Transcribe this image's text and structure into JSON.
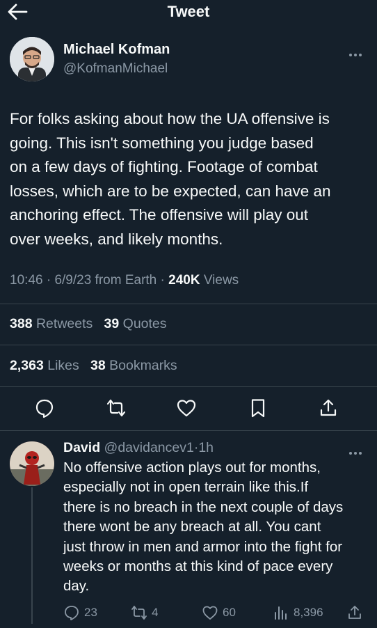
{
  "header": {
    "title": "Tweet",
    "back_icon": "arrow-left-icon"
  },
  "tweet": {
    "author_name": "Michael Kofman",
    "author_handle": "@KofmanMichael",
    "text_lines": [
      "For folks asking about how the UA offensive is",
      "going. This isn't something you judge based",
      "on a few days of fighting. Footage of combat",
      "losses, which are to be expected, can have an",
      "anchoring effect. The offensive will play out",
      "over weeks, and likely months."
    ],
    "time": "10:46",
    "date": "6/9/23",
    "source": "from Earth",
    "separator": "·",
    "views_count": "240K",
    "views_label": "Views",
    "retweets_count": "388",
    "retweets_label": "Retweets",
    "quotes_count": "39",
    "quotes_label": "Quotes",
    "likes_count": "2,363",
    "likes_label": "Likes",
    "bookmarks_count": "38",
    "bookmarks_label": "Bookmarks"
  },
  "reply": {
    "author_name": "David",
    "author_handle": "@davidancev1",
    "separator": "·",
    "age": "1h",
    "text_lines": [
      "No offensive action plays out for months,",
      "especially not in open terrain like this.If",
      "there is no breach in the next couple of days",
      "there wont be any breach at all. You cant",
      "just throw in men and armor into the fight for",
      "weeks or months at this kind of pace every",
      "day."
    ],
    "replies": "23",
    "retweets": "4",
    "likes": "60",
    "views": "8,396"
  },
  "colors": {
    "background": "#15202b",
    "text": "#f7f9f9",
    "secondary": "#8b98a5",
    "divider": "#38444d"
  }
}
